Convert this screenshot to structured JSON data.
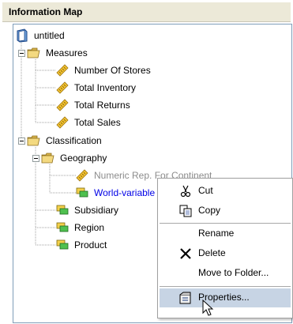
{
  "window": {
    "title": "Information Map"
  },
  "tree": {
    "root": {
      "label": "untitled",
      "icon": "map-icon"
    },
    "measures_folder": {
      "label": "Measures",
      "icon": "folder-open-icon"
    },
    "measures": [
      {
        "label": "Number Of Stores",
        "icon": "measure-ruler-icon"
      },
      {
        "label": "Total Inventory",
        "icon": "measure-ruler-icon"
      },
      {
        "label": "Total Returns",
        "icon": "measure-ruler-icon"
      },
      {
        "label": "Total Sales",
        "icon": "measure-ruler-icon"
      }
    ],
    "classification_folder": {
      "label": "Classification",
      "icon": "folder-open-icon"
    },
    "geography_folder": {
      "label": "Geography",
      "icon": "folder-open-icon"
    },
    "geography_items": [
      {
        "label": "Numeric Rep. For Continent",
        "icon": "measure-ruler-icon",
        "state": "disabled"
      },
      {
        "label": "World-variable",
        "icon": "category-icon",
        "state": "selected"
      }
    ],
    "classification_items": [
      {
        "label": "Subsidiary",
        "icon": "category-icon"
      },
      {
        "label": "Region",
        "icon": "category-icon"
      },
      {
        "label": "Product",
        "icon": "category-icon"
      }
    ]
  },
  "context_menu": {
    "items": {
      "cut": {
        "label": "Cut",
        "icon": "scissors-icon"
      },
      "copy": {
        "label": "Copy",
        "icon": "copy-icon"
      },
      "rename": {
        "label": "Rename"
      },
      "delete": {
        "label": "Delete",
        "icon": "delete-x-icon"
      },
      "move": {
        "label": "Move to Folder..."
      },
      "properties": {
        "label": "Properties...",
        "icon": "properties-icon",
        "highlighted": true
      }
    }
  },
  "colors": {
    "selected_text": "#0000e6",
    "disabled_text": "#8c8c8c",
    "menu_highlight": "#c7d4e4",
    "folder": "#e9c96a",
    "ruler": "#e8b830",
    "category": "#3fae3f"
  }
}
